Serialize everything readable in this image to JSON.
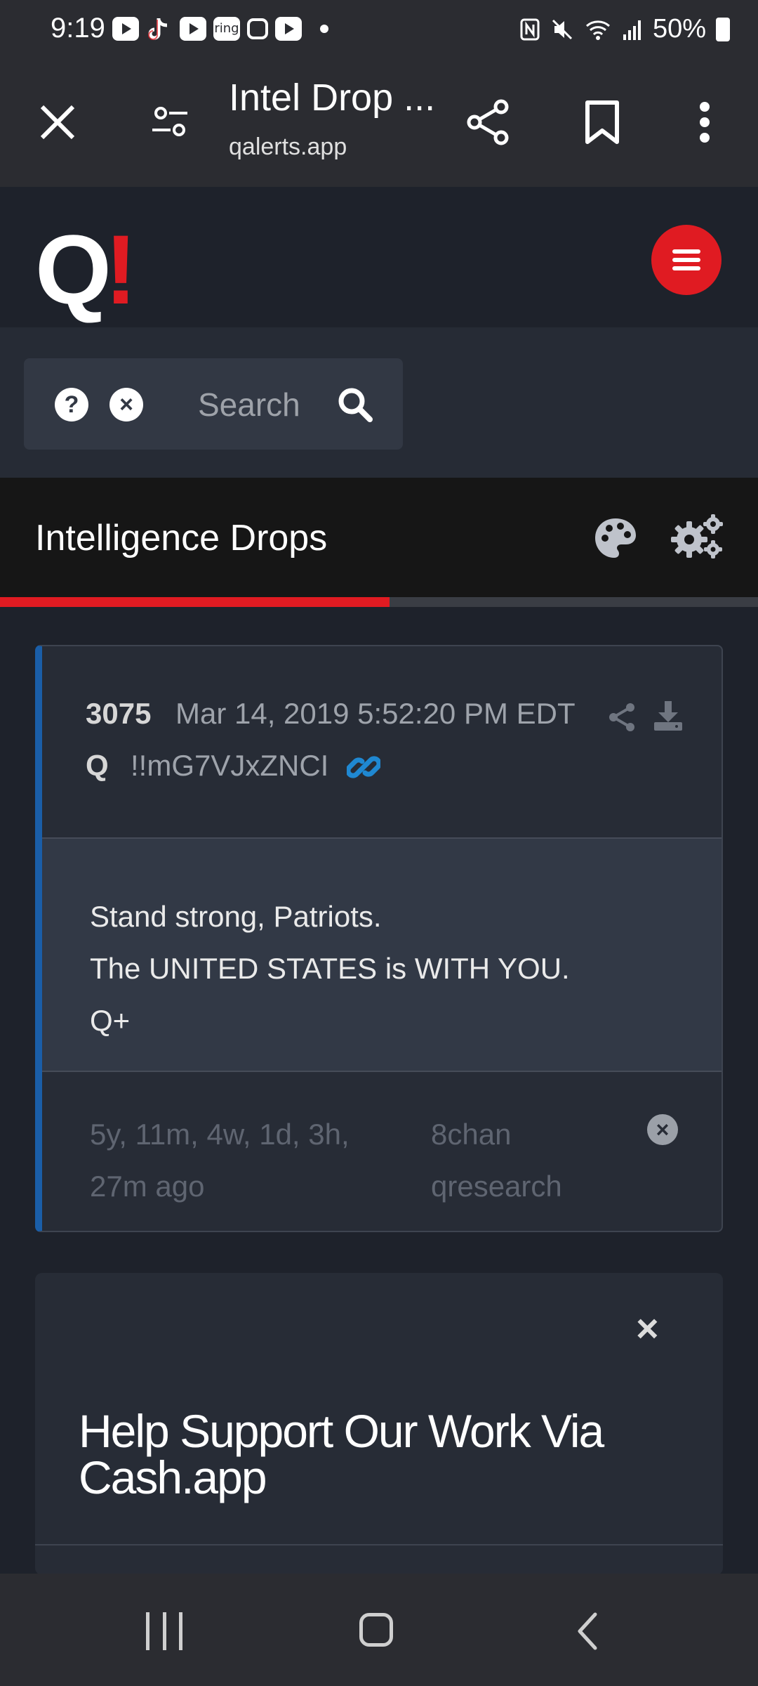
{
  "status_bar": {
    "time": "9:19",
    "notification_icons": [
      "youtube-icon",
      "tiktok-icon",
      "youtube-icon",
      "ring-icon",
      "instagram-icon",
      "youtube-icon"
    ],
    "ring_label": "ring",
    "battery": "50%"
  },
  "browser": {
    "title": "Intel Drop ...",
    "url": "qalerts.app"
  },
  "site": {
    "logo_q": "Q",
    "logo_bang": "!",
    "accent_color": "#e01b22"
  },
  "search": {
    "placeholder": "Search",
    "help_glyph": "?",
    "clear_glyph": "×"
  },
  "section": {
    "title": "Intelligence Drops",
    "progress_fraction": 0.514
  },
  "drop": {
    "number": "3075",
    "date": "Mar 14, 2019 5:52:20 PM EDT",
    "author": "Q",
    "tripcode": "!!mG7VJxZNCI",
    "body_lines": [
      "Stand strong, Patriots.",
      "The UNITED STATES is WITH YOU.",
      "Q+"
    ],
    "ago": "5y, 11m, 4w, 1d, 3h, 27m ago",
    "source": "8chan qresearch",
    "accent_color": "#1a5ea8"
  },
  "support": {
    "close_glyph": "×",
    "heading": "Help Support Our Work Via Cash.app"
  }
}
